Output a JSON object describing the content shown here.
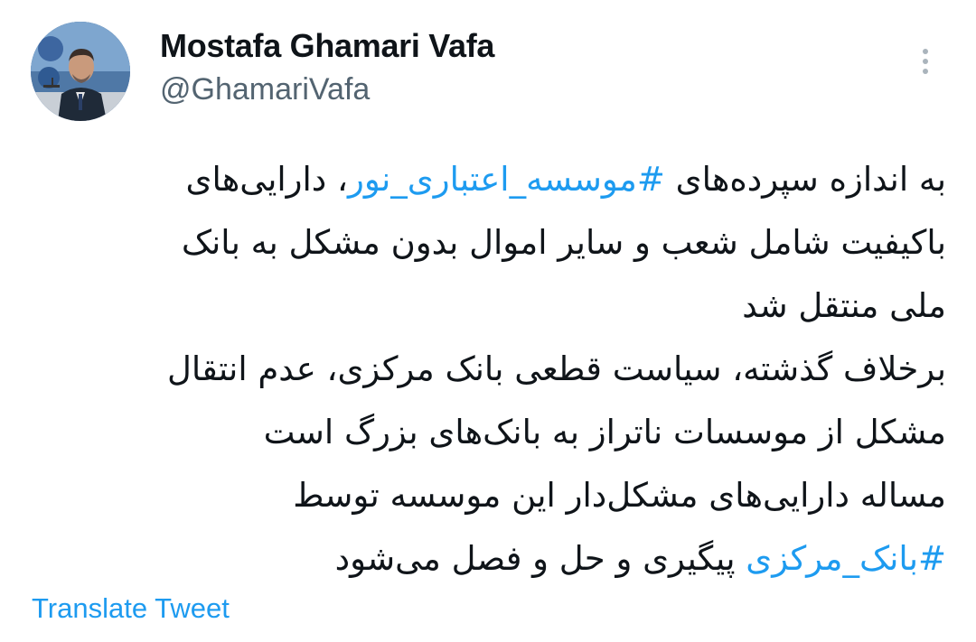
{
  "author": {
    "name": "Mostafa Ghamari Vafa",
    "handle": "@GhamariVafa"
  },
  "menu": {
    "icon": "more-vertical-icon"
  },
  "tweet": {
    "lines": [
      {
        "segments": [
          {
            "text": "به اندازه سپرده‌های ",
            "hashtag": false
          },
          {
            "text": "#موسسه_اعتباری_نور",
            "hashtag": true
          },
          {
            "text": "، دارایی‌های",
            "hashtag": false
          }
        ]
      },
      {
        "segments": [
          {
            "text": "باکیفیت شامل شعب و سایر اموال بدون مشکل به بانک",
            "hashtag": false
          }
        ]
      },
      {
        "segments": [
          {
            "text": "ملی منتقل شد",
            "hashtag": false
          }
        ]
      },
      {
        "segments": [
          {
            "text": "برخلاف گذشته، سیاست قطعی بانک مرکزی، عدم انتقال",
            "hashtag": false
          }
        ]
      },
      {
        "segments": [
          {
            "text": "مشکل از موسسات ناتراز به بانک‌های بزرگ است",
            "hashtag": false
          }
        ]
      },
      {
        "segments": [
          {
            "text": "مساله دارایی‌های مشکل‌دار این موسسه توسط",
            "hashtag": false
          }
        ]
      },
      {
        "segments": [
          {
            "text": "#بانک_مرکزی",
            "hashtag": true
          },
          {
            "text": " پیگیری و حل و فصل می‌شود",
            "hashtag": false
          }
        ]
      }
    ]
  },
  "actions": {
    "translate_label": "Translate Tweet"
  },
  "colors": {
    "link": "#1d9bf0",
    "secondary_text": "#536471",
    "primary_text": "#0f1419"
  }
}
